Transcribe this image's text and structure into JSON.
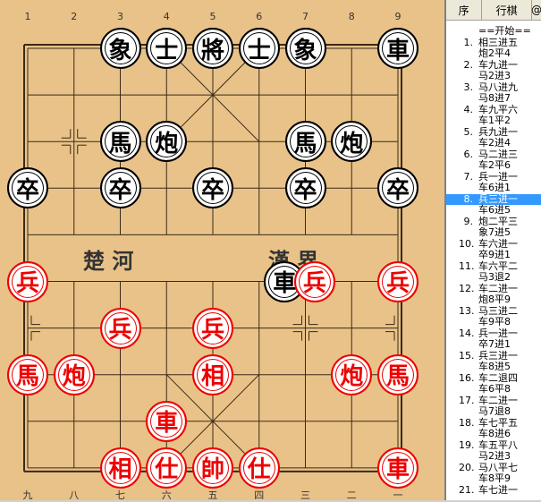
{
  "board": {
    "top_files": [
      "1",
      "2",
      "3",
      "4",
      "5",
      "6",
      "7",
      "8",
      "9"
    ],
    "bottom_files": [
      "九",
      "八",
      "七",
      "六",
      "五",
      "四",
      "三",
      "二",
      "一"
    ],
    "river_left": "楚 河",
    "river_right": "漢 界",
    "pieces": [
      {
        "name": "black-elephant-3",
        "label": "象",
        "side": "black",
        "file": 2,
        "rank": 0
      },
      {
        "name": "black-advisor-4",
        "label": "士",
        "side": "black",
        "file": 3,
        "rank": 0
      },
      {
        "name": "black-general",
        "label": "將",
        "side": "black",
        "file": 4,
        "rank": 0
      },
      {
        "name": "black-advisor-6",
        "label": "士",
        "side": "black",
        "file": 5,
        "rank": 0
      },
      {
        "name": "black-elephant-7",
        "label": "象",
        "side": "black",
        "file": 6,
        "rank": 0
      },
      {
        "name": "black-chariot-9",
        "label": "車",
        "side": "black",
        "file": 8,
        "rank": 0
      },
      {
        "name": "black-horse-3",
        "label": "馬",
        "side": "black",
        "file": 2,
        "rank": 2
      },
      {
        "name": "black-cannon-4",
        "label": "炮",
        "side": "black",
        "file": 3,
        "rank": 2
      },
      {
        "name": "black-horse-7",
        "label": "馬",
        "side": "black",
        "file": 6,
        "rank": 2
      },
      {
        "name": "black-cannon-8",
        "label": "炮",
        "side": "black",
        "file": 7,
        "rank": 2
      },
      {
        "name": "black-soldier-1",
        "label": "卒",
        "side": "black",
        "file": 0,
        "rank": 3
      },
      {
        "name": "black-soldier-3",
        "label": "卒",
        "side": "black",
        "file": 2,
        "rank": 3
      },
      {
        "name": "black-soldier-5",
        "label": "卒",
        "side": "black",
        "file": 4,
        "rank": 3
      },
      {
        "name": "black-soldier-7",
        "label": "卒",
        "side": "black",
        "file": 6,
        "rank": 3
      },
      {
        "name": "black-soldier-9",
        "label": "卒",
        "side": "black",
        "file": 8,
        "rank": 3
      },
      {
        "name": "black-chariot-river",
        "label": "車",
        "side": "black",
        "file": 5.55,
        "rank": 5
      },
      {
        "name": "red-soldier-1",
        "label": "兵",
        "side": "red",
        "file": 0,
        "rank": 5
      },
      {
        "name": "red-soldier-7",
        "label": "兵",
        "side": "red",
        "file": 6.2,
        "rank": 5
      },
      {
        "name": "red-soldier-9",
        "label": "兵",
        "side": "red",
        "file": 8,
        "rank": 5
      },
      {
        "name": "red-soldier-3",
        "label": "兵",
        "side": "red",
        "file": 2,
        "rank": 6
      },
      {
        "name": "red-soldier-5",
        "label": "兵",
        "side": "red",
        "file": 4,
        "rank": 6
      },
      {
        "name": "red-horse-1",
        "label": "馬",
        "side": "red",
        "file": 0,
        "rank": 7
      },
      {
        "name": "red-cannon-2",
        "label": "炮",
        "side": "red",
        "file": 1,
        "rank": 7
      },
      {
        "name": "red-elephant-5",
        "label": "相",
        "side": "red",
        "file": 4,
        "rank": 7
      },
      {
        "name": "red-cannon-8",
        "label": "炮",
        "side": "red",
        "file": 7,
        "rank": 7
      },
      {
        "name": "red-horse-9",
        "label": "馬",
        "side": "red",
        "file": 8,
        "rank": 7
      },
      {
        "name": "red-chariot-4",
        "label": "車",
        "side": "red",
        "file": 3,
        "rank": 8
      },
      {
        "name": "red-elephant-3",
        "label": "相",
        "side": "red",
        "file": 2,
        "rank": 9
      },
      {
        "name": "red-advisor-4",
        "label": "仕",
        "side": "red",
        "file": 3,
        "rank": 9
      },
      {
        "name": "red-general",
        "label": "帥",
        "side": "red",
        "file": 4,
        "rank": 9
      },
      {
        "name": "red-advisor-6",
        "label": "仕",
        "side": "red",
        "file": 5,
        "rank": 9
      },
      {
        "name": "red-chariot-9",
        "label": "車",
        "side": "red",
        "file": 8,
        "rank": 9
      }
    ]
  },
  "move_list": {
    "header_seq": "序",
    "header_moves": "行棋",
    "header_at": "@",
    "rows": [
      {
        "num": "",
        "text": "==开始==",
        "selected": false
      },
      {
        "num": "1.",
        "text": "相三进五",
        "selected": false
      },
      {
        "num": "",
        "text": "炮2平4",
        "selected": false
      },
      {
        "num": "2.",
        "text": "车九进一",
        "selected": false
      },
      {
        "num": "",
        "text": "马2进3",
        "selected": false
      },
      {
        "num": "3.",
        "text": "马八进九",
        "selected": false
      },
      {
        "num": "",
        "text": "马8进7",
        "selected": false
      },
      {
        "num": "4.",
        "text": "车九平六",
        "selected": false
      },
      {
        "num": "",
        "text": "车1平2",
        "selected": false
      },
      {
        "num": "5.",
        "text": "兵九进一",
        "selected": false
      },
      {
        "num": "",
        "text": "车2进4",
        "selected": false
      },
      {
        "num": "6.",
        "text": "马二进三",
        "selected": false
      },
      {
        "num": "",
        "text": "车2平6",
        "selected": false
      },
      {
        "num": "7.",
        "text": "兵一进一",
        "selected": false
      },
      {
        "num": "",
        "text": "车6进1",
        "selected": false
      },
      {
        "num": "8.",
        "text": "兵三进一",
        "selected": true
      },
      {
        "num": "",
        "text": "车6进5",
        "selected": false
      },
      {
        "num": "9.",
        "text": "炮二平三",
        "selected": false
      },
      {
        "num": "",
        "text": "象7进5",
        "selected": false
      },
      {
        "num": "10.",
        "text": "车六进一",
        "selected": false
      },
      {
        "num": "",
        "text": "卒9进1",
        "selected": false
      },
      {
        "num": "11.",
        "text": "车六平二",
        "selected": false
      },
      {
        "num": "",
        "text": "马3退2",
        "selected": false
      },
      {
        "num": "12.",
        "text": "车二进一",
        "selected": false
      },
      {
        "num": "",
        "text": "炮8平9",
        "selected": false
      },
      {
        "num": "13.",
        "text": "马三进二",
        "selected": false
      },
      {
        "num": "",
        "text": "车9平8",
        "selected": false
      },
      {
        "num": "14.",
        "text": "兵一进一",
        "selected": false
      },
      {
        "num": "",
        "text": "卒7进1",
        "selected": false
      },
      {
        "num": "15.",
        "text": "兵三进一",
        "selected": false
      },
      {
        "num": "",
        "text": "车8进5",
        "selected": false
      },
      {
        "num": "16.",
        "text": "车二退四",
        "selected": false
      },
      {
        "num": "",
        "text": "车6平8",
        "selected": false
      },
      {
        "num": "17.",
        "text": "车二进一",
        "selected": false
      },
      {
        "num": "",
        "text": "马7退8",
        "selected": false
      },
      {
        "num": "18.",
        "text": "车七平五",
        "selected": false
      },
      {
        "num": "",
        "text": "车8进6",
        "selected": false
      },
      {
        "num": "19.",
        "text": "车五平八",
        "selected": false
      },
      {
        "num": "",
        "text": "马2进3",
        "selected": false
      },
      {
        "num": "20.",
        "text": "马八平七",
        "selected": false
      },
      {
        "num": "",
        "text": "车8平9",
        "selected": false
      },
      {
        "num": "21.",
        "text": "车七进一",
        "selected": false
      }
    ]
  }
}
